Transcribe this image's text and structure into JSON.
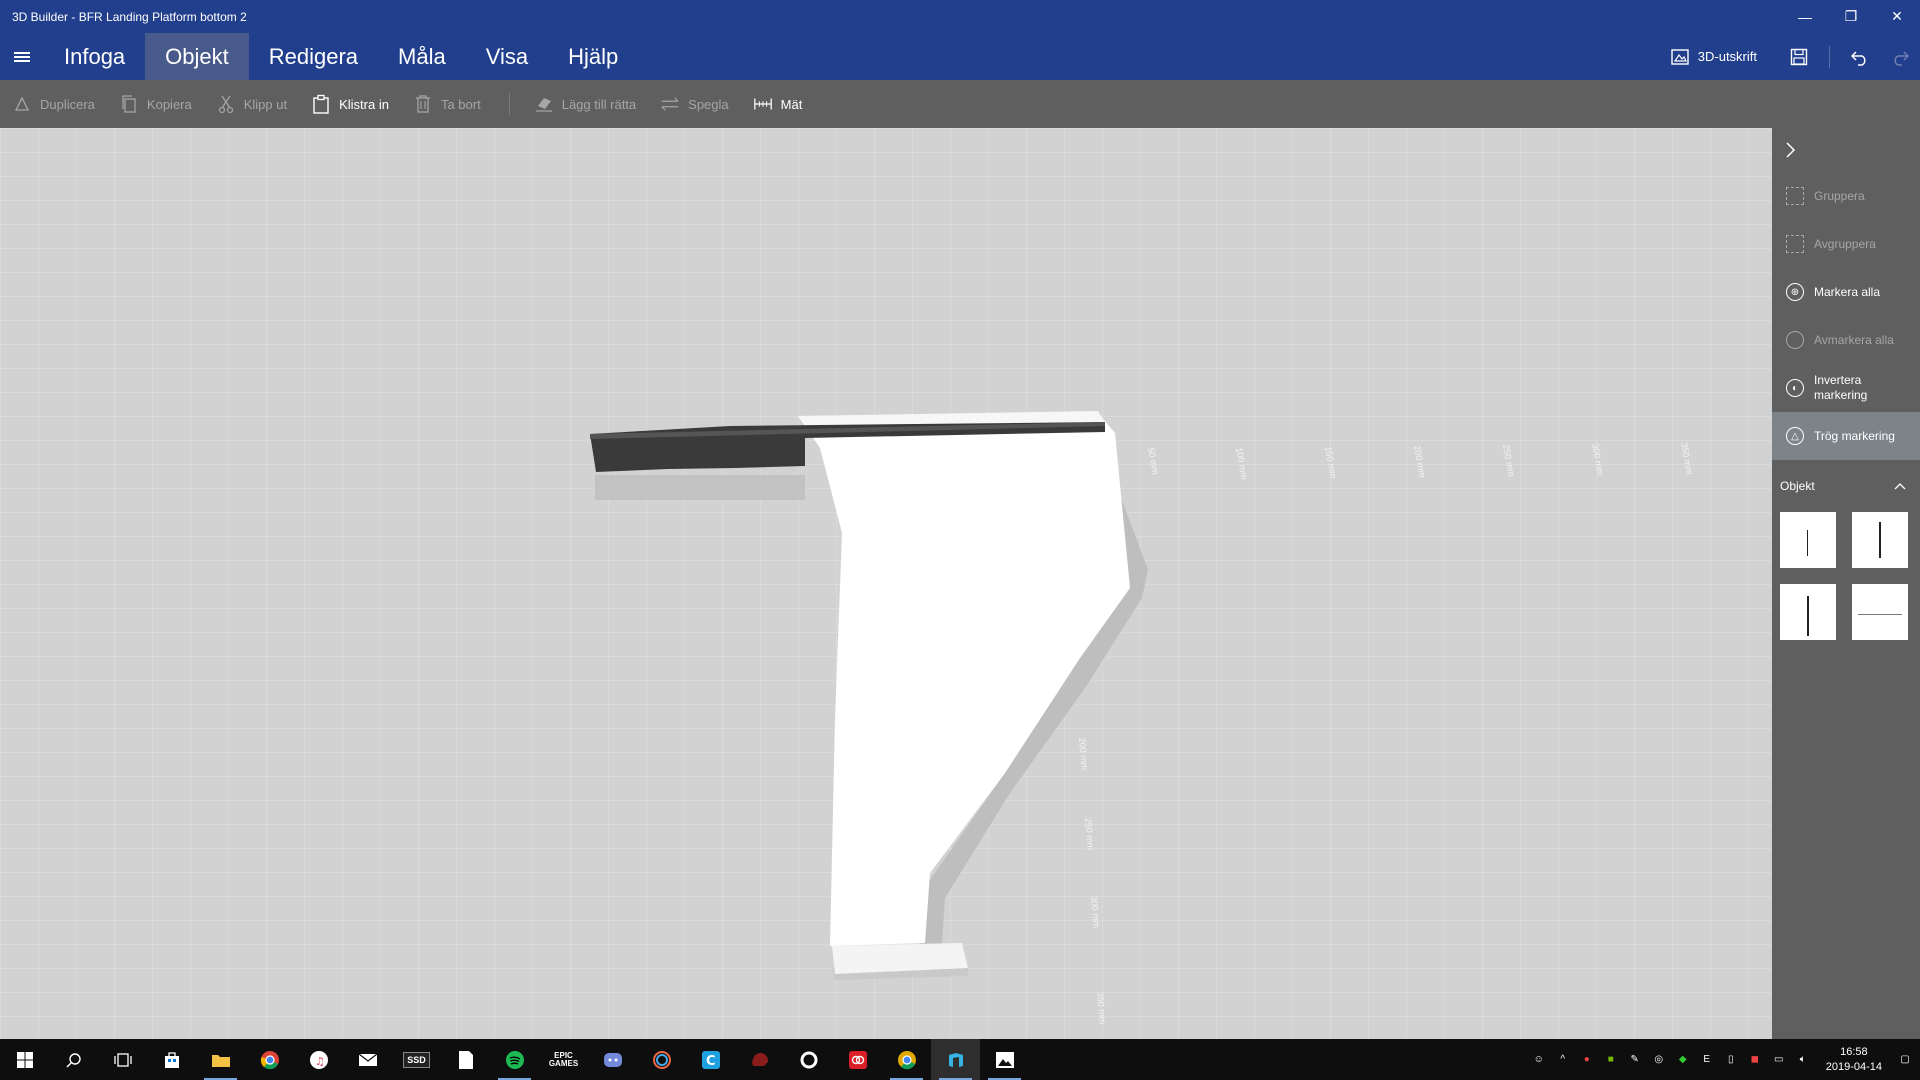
{
  "window": {
    "title": "3D Builder - BFR Landing Platform bottom 2",
    "controls": {
      "minimize": "—",
      "restore": "❐",
      "close": "✕"
    }
  },
  "menu": {
    "tabs": [
      "Infoga",
      "Objekt",
      "Redigera",
      "Måla",
      "Visa",
      "Hjälp"
    ],
    "active_tab": "Objekt",
    "print_label": "3D-utskrift"
  },
  "toolbar": {
    "duplicate": "Duplicera",
    "copy": "Kopiera",
    "cut": "Klipp ut",
    "paste": "Klistra in",
    "delete": "Ta bort",
    "settle": "Lägg till rätta",
    "mirror": "Spegla",
    "measure": "Mät"
  },
  "canvas": {
    "ruler_top": [
      "50 mm",
      "100 mm",
      "150 mm",
      "200 mm",
      "250 mm",
      "300 mm",
      "350 mm"
    ],
    "ruler_side": [
      "200 mm",
      "250 mm",
      "300 mm",
      "350 mm"
    ],
    "colors": {
      "floor": "#d2d2d2",
      "object": "#ffffff",
      "bar": "#3c3c3c"
    }
  },
  "right_panel": {
    "group": "Gruppera",
    "ungroup": "Avgruppera",
    "select_all": "Markera alla",
    "deselect_all": "Avmarkera alla",
    "invert_selection": "Invertera markering",
    "lazy_selection": "Trög markering",
    "objects_header": "Objekt"
  },
  "taskbar": {
    "apps": [
      "windows-start",
      "search",
      "task-view",
      "store",
      "file-explorer",
      "chrome",
      "itunes",
      "mail",
      "ssd-tool",
      "notepad",
      "spotify",
      "epic-games",
      "discord",
      "aura",
      "ccleaner",
      "mcafee",
      "origin",
      "adobe-cc",
      "chrome-canary",
      "3d-builder",
      "photos"
    ],
    "clock_time": "16:58",
    "clock_date": "2019-04-14"
  }
}
